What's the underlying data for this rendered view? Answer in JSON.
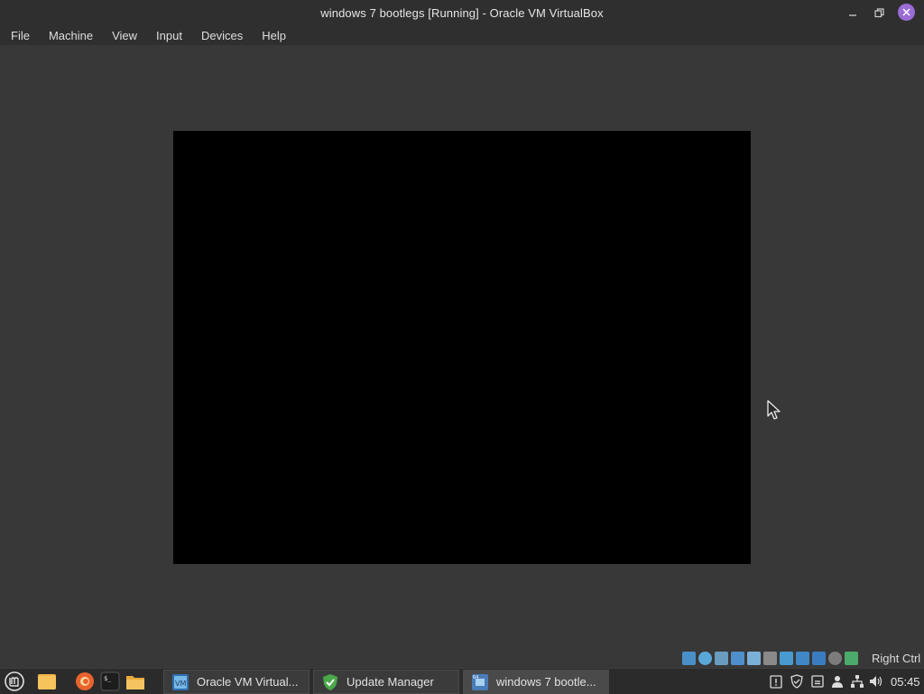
{
  "window": {
    "title": "windows 7 bootlegs [Running] - Oracle VM VirtualBox",
    "minimize_icon": "minimize-icon",
    "maximize_icon": "restore-icon",
    "close_icon": "close-icon"
  },
  "menubar": {
    "items": [
      "File",
      "Machine",
      "View",
      "Input",
      "Devices",
      "Help"
    ]
  },
  "vm": {
    "state": "Running",
    "screen_color": "#000000"
  },
  "statusbar": {
    "icons": [
      "hard-disk-icon",
      "optical-drive-icon",
      "audio-icon",
      "network-icon",
      "usb-icon",
      "shared-folders-icon",
      "display-icon",
      "video-capture-icon",
      "virtualization-icon",
      "mouse-integration-icon",
      "keyboard-icon"
    ],
    "host_key": "Right Ctrl"
  },
  "taskbar": {
    "launchers": [
      "mint-menu-icon",
      "files-icon",
      "firefox-icon",
      "terminal-icon",
      "folder-icon"
    ],
    "windows": [
      {
        "label": "Oracle VM Virtual...",
        "icon": "virtualbox-icon"
      },
      {
        "label": "Update Manager",
        "icon": "update-manager-icon"
      },
      {
        "label": "windows 7 bootle...",
        "icon": "vm-window-icon"
      }
    ],
    "tray": [
      "clipboard-icon",
      "shield-icon",
      "battery-icon",
      "user-icon",
      "network-icon",
      "volume-icon"
    ],
    "clock": "05:45"
  },
  "colors": {
    "background": "#383838",
    "titlebar": "#2f2f2f",
    "close_button": "#9b6bd6",
    "taskbar": "#2b2b2b"
  }
}
